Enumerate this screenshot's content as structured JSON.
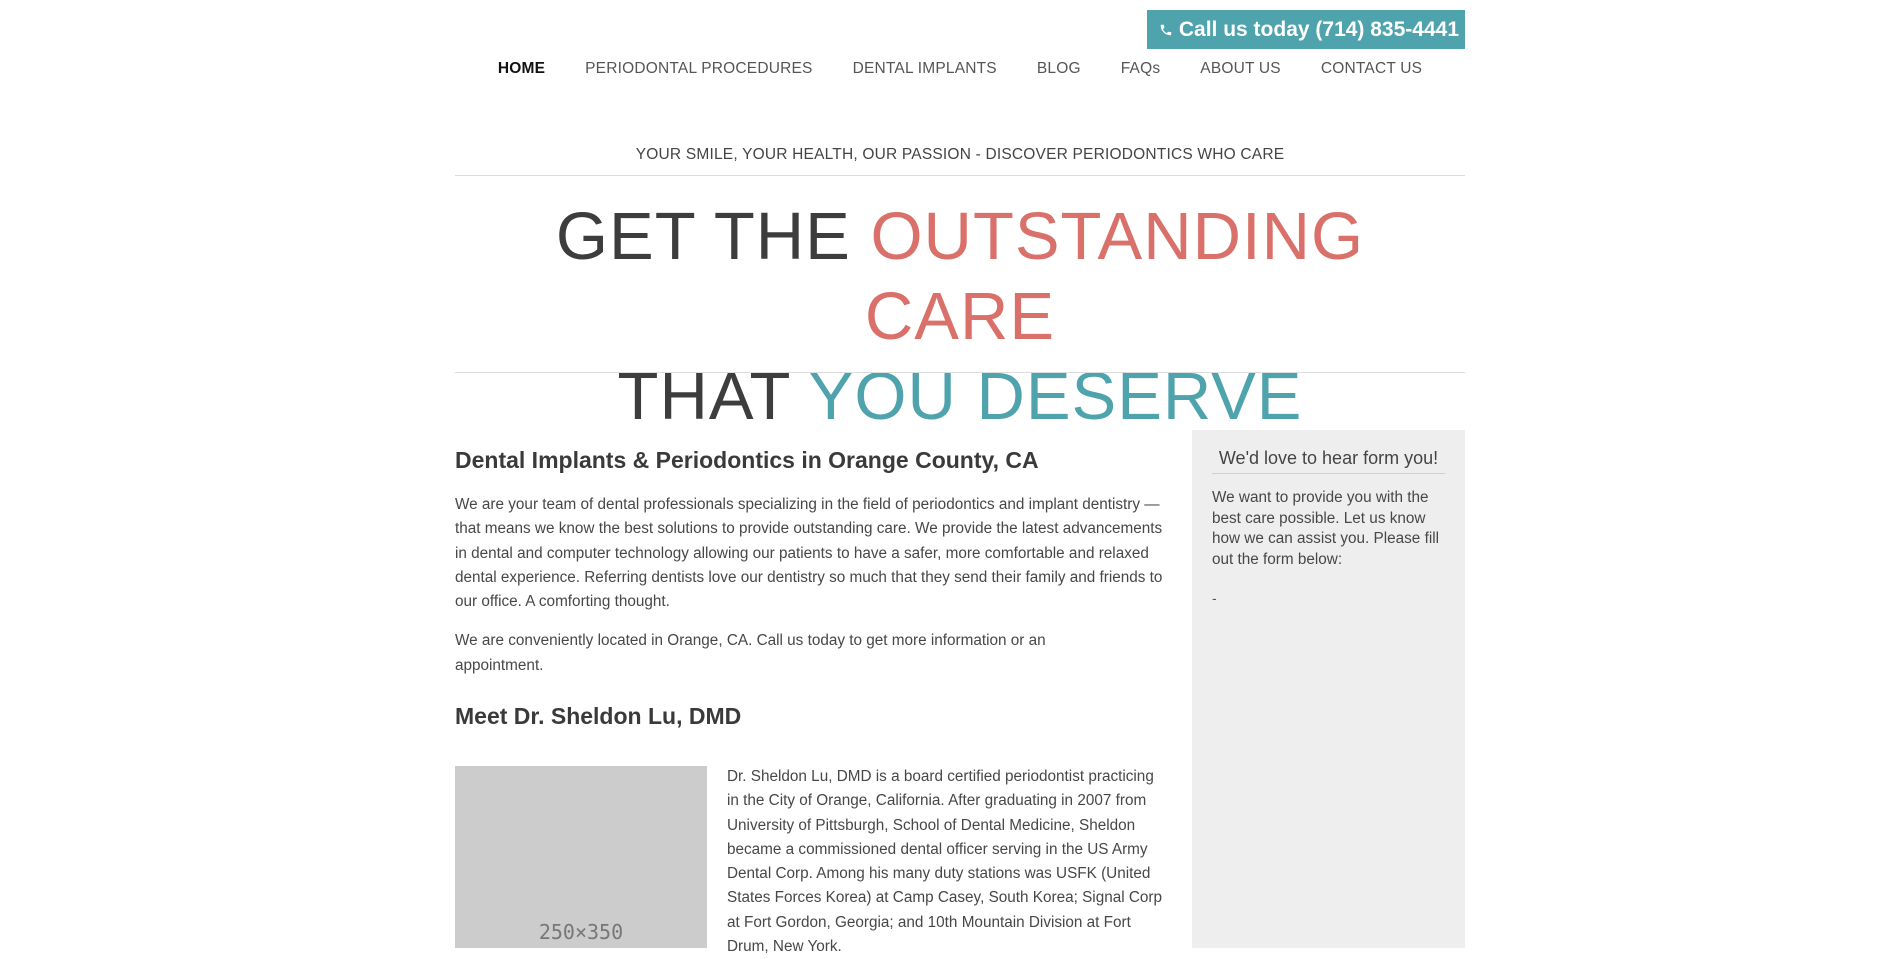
{
  "header": {
    "call_button": "Call us today (714) 835-4441",
    "call_icon": "phone-icon"
  },
  "nav": {
    "items": [
      {
        "label": "HOME",
        "active": true
      },
      {
        "label": "PERIODONTAL PROCEDURES"
      },
      {
        "label": "DENTAL IMPLANTS"
      },
      {
        "label": "BLOG"
      },
      {
        "label": "FAQs"
      },
      {
        "label": "ABOUT US"
      },
      {
        "label": "CONTACT US"
      }
    ]
  },
  "hero": {
    "tagline": "YOUR SMILE, YOUR HEALTH, OUR PASSION - DISCOVER PERIODONTICS WHO CARE",
    "line1_a": "GET THE ",
    "line1_b": "OUTSTANDING CARE",
    "line2_a": "THAT ",
    "line2_b": "YOU DESERVE"
  },
  "main": {
    "heading1": "Dental Implants & Periodontics in Orange County, CA",
    "para1": "We are your team of dental professionals specializing in the field of periodontics and implant dentistry — that means we know the best solutions to provide outstanding care. We provide the latest advancements in dental and computer technology allowing our patients to have a safer, more comfortable and relaxed dental experience. Referring dentists love our dentistry so much that they send their family and friends to our office. A comforting thought.",
    "para2": "We are conveniently located in Orange, CA. Call us today to get more information or an appointment.",
    "heading2": "Meet Dr. Sheldon Lu, DMD",
    "image_placeholder": "250×350",
    "bio": "Dr. Sheldon Lu, DMD is a board certified periodontist practicing in the City of Orange, California. After graduating in 2007 from University of Pittsburgh, School of Dental Medicine, Sheldon became a commissioned dental officer serving in the US Army Dental Corp. Among his many duty stations was USFK (United States Forces Korea) at Camp Casey, South Korea; Signal Corp at Fort Gordon, Georgia; and 10th Mountain Division at Fort Drum, New York."
  },
  "aside": {
    "title": "We'd love to hear form you!",
    "text": "We want to provide you with the best care possible. Let us know how we can assist you. Please fill out the form below:",
    "dash": "-"
  },
  "colors": {
    "accent_teal": "#4ea3ad",
    "accent_red": "#d9706a",
    "sidebar_bg": "#eeeeee"
  }
}
